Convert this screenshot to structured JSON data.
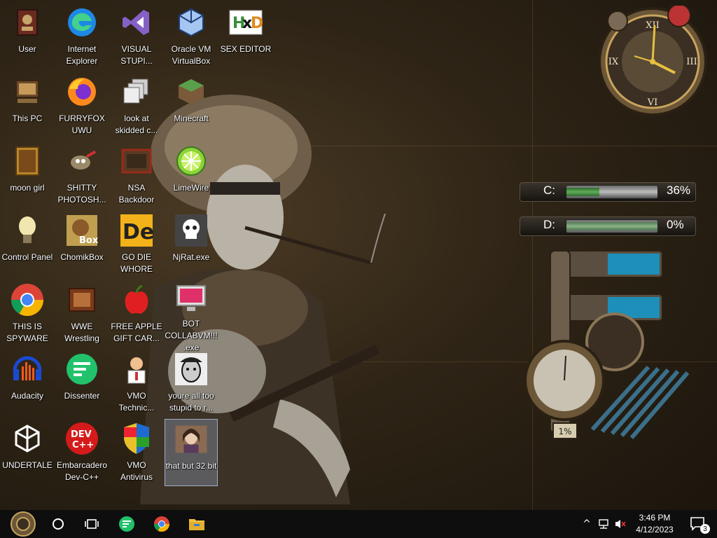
{
  "desktop": {
    "icons": [
      {
        "label": "User",
        "icon": "user-folder-icon"
      },
      {
        "label": "Internet Explorer",
        "icon": "edge-icon"
      },
      {
        "label": "VISUAL STUPI...",
        "icon": "visual-studio-icon"
      },
      {
        "label": "Oracle VM VirtualBox",
        "icon": "virtualbox-icon"
      },
      {
        "label": "SEX EDITOR",
        "icon": "hxd-icon"
      },
      {
        "label": "This PC",
        "icon": "this-pc-icon"
      },
      {
        "label": "FURRYFOX UWU",
        "icon": "firefox-icon"
      },
      {
        "label": "look at skidded c...",
        "icon": "shortcut-stack-icon"
      },
      {
        "label": "Minecraft",
        "icon": "minecraft-icon"
      },
      {
        "label": "moon girl",
        "icon": "moon-girl-icon"
      },
      {
        "label": "SHITTY PHOTOSH...",
        "icon": "gimp-icon"
      },
      {
        "label": "NSA Backdoor",
        "icon": "nsa-backdoor-icon"
      },
      {
        "label": "LimeWire",
        "icon": "limewire-icon"
      },
      {
        "label": "Control Panel",
        "icon": "control-panel-icon"
      },
      {
        "label": "ChomikBox",
        "icon": "chomikbox-icon"
      },
      {
        "label": "GO DIE WHORE",
        "icon": "de-icon"
      },
      {
        "label": "NjRat.exe",
        "icon": "skull-icon"
      },
      {
        "label": "THIS IS SPYWARE",
        "icon": "chrome-icon"
      },
      {
        "label": "WWE Wrestling",
        "icon": "wwe-icon"
      },
      {
        "label": "FREE APPLE GIFT CAR...",
        "icon": "apple-icon"
      },
      {
        "label": "BOT COLLABVM!!!.exe",
        "icon": "bot-monitor-icon"
      },
      {
        "label": "Audacity",
        "icon": "audacity-icon"
      },
      {
        "label": "Dissenter",
        "icon": "dissenter-icon"
      },
      {
        "label": "VMO Technic...",
        "icon": "technician-icon"
      },
      {
        "label": "youre all too stupid to r...",
        "icon": "face-sketch-icon"
      },
      {
        "label": "UNDERTALE",
        "icon": "unity-icon"
      },
      {
        "label": "Embarcadero Dev-C++",
        "icon": "devcpp-icon"
      },
      {
        "label": "VMO Antivirus",
        "icon": "shield-icon"
      },
      {
        "label": "that but 32 bit",
        "icon": "portrait-icon"
      }
    ]
  },
  "gadgets": {
    "drives": [
      {
        "letter": "C:",
        "percent_text": "36%",
        "fill_fraction": 0.36
      },
      {
        "letter": "D:",
        "percent_text": "0%",
        "fill_fraction": 0.0
      }
    ],
    "meter_label": "1%",
    "clock_numerals": [
      "XII",
      "III",
      "VI",
      "IX"
    ]
  },
  "taskbar": {
    "time": "3:46 PM",
    "date": "4/12/2023",
    "notification_count": "3"
  },
  "colors": {
    "taskbar": "#0e0e0e",
    "drive_fill": "#5fae5a"
  }
}
